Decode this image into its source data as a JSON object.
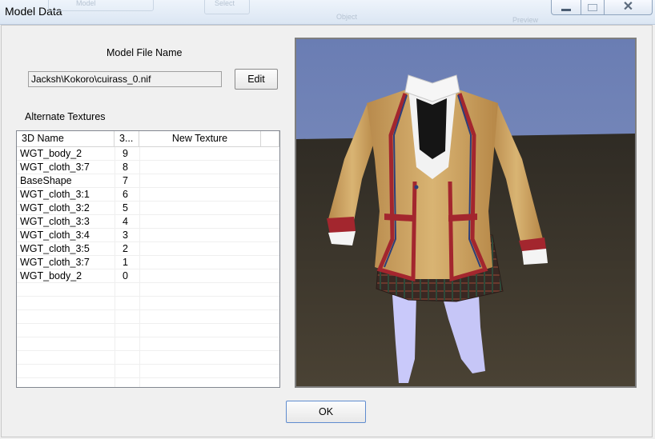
{
  "window": {
    "title": "Model Data",
    "ghost_text": [
      "Model",
      "Select",
      "Object",
      "Preview"
    ]
  },
  "model_file": {
    "label": "Model File Name",
    "value": "Jacksh\\Kokoro\\cuirass_0.nif",
    "edit_label": "Edit"
  },
  "textures": {
    "label": "Alternate Textures",
    "columns": [
      "3D Name",
      "3...",
      "New Texture"
    ],
    "rows": [
      {
        "name": "WGT_body_2",
        "index": "9",
        "texture": ""
      },
      {
        "name": "WGT_cloth_3:7",
        "index": "8",
        "texture": ""
      },
      {
        "name": "BaseShape",
        "index": "7",
        "texture": ""
      },
      {
        "name": "WGT_cloth_3:1",
        "index": "6",
        "texture": ""
      },
      {
        "name": "WGT_cloth_3:2",
        "index": "5",
        "texture": ""
      },
      {
        "name": "WGT_cloth_3:3",
        "index": "4",
        "texture": ""
      },
      {
        "name": "WGT_cloth_3:4",
        "index": "3",
        "texture": ""
      },
      {
        "name": "WGT_cloth_3:5",
        "index": "2",
        "texture": ""
      },
      {
        "name": "WGT_cloth_3:7",
        "index": "1",
        "texture": ""
      },
      {
        "name": "WGT_body_2",
        "index": "0",
        "texture": ""
      }
    ]
  },
  "buttons": {
    "ok_label": "OK"
  },
  "colors": {
    "sky": "#6b7fb3",
    "ground": "#3b352c",
    "jacket": "#d2a865",
    "trim": "#a3262e",
    "skirt": "#3f2a24",
    "legs": "#c8c8f8"
  }
}
